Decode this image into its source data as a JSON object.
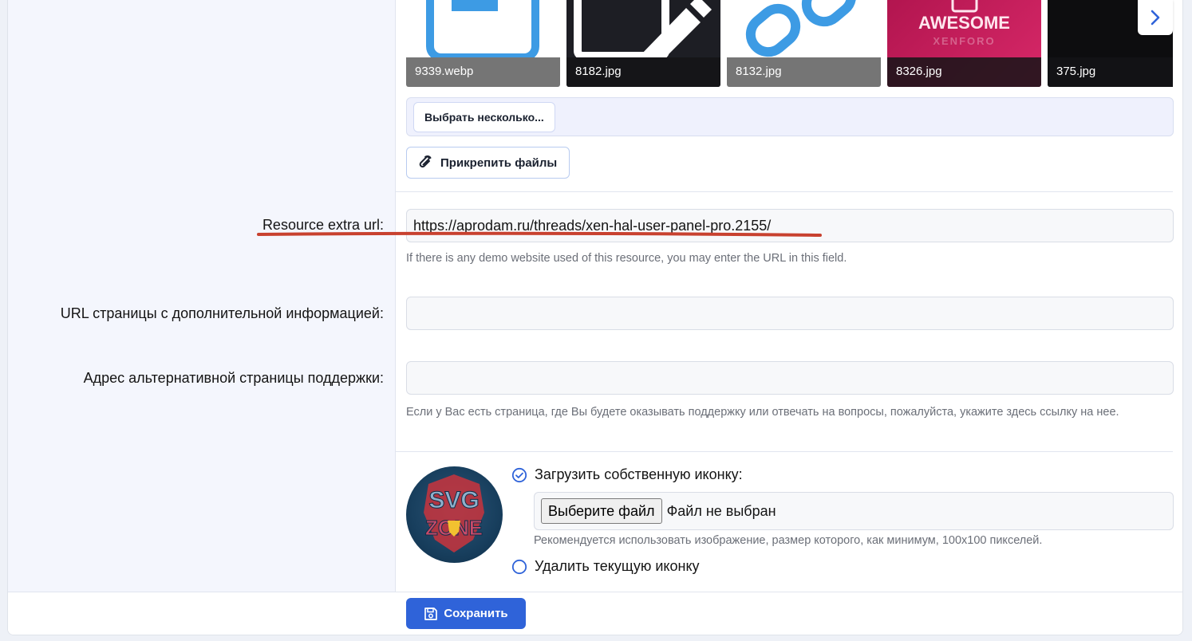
{
  "thumbnails": [
    {
      "caption": "9339.webp",
      "icon": "document-icon"
    },
    {
      "caption": "8182.jpg",
      "icon": "pencil-icon"
    },
    {
      "caption": "8132.jpg",
      "icon": "link-icon"
    },
    {
      "caption": "8326.jpg",
      "title": "AWESOME",
      "subtitle": "XENFORO"
    },
    {
      "caption": "375.jpg"
    }
  ],
  "gallery": {
    "next_icon": "chevron-right-icon"
  },
  "multi_select": {
    "label": "Выбрать несколько..."
  },
  "attach": {
    "label": "Прикрепить файлы",
    "icon": "paperclip-icon"
  },
  "fields": {
    "extra_url": {
      "label": "Resource extra url:",
      "value": "https://aprodam.ru/threads/xen-hal-user-panel-pro.2155/",
      "hint": "If there is any demo website used of this resource, you may enter the URL in this field."
    },
    "info_url": {
      "label": "URL страницы с дополнительной информацией:",
      "value": ""
    },
    "support_url": {
      "label": "Адрес альтернативной страницы поддержки:",
      "value": "",
      "hint": "Если у Вас есть страница, где Вы будете оказывать поддержку или отвечать на вопросы, пожалуйста, укажите здесь ссылку на нее."
    }
  },
  "icon_section": {
    "avatar_text": "SVG ZONE",
    "upload_option": "Загрузить собственную иконку:",
    "file_button": "Выберите файл",
    "file_status": "Файл не выбран",
    "file_hint": "Рекомендуется использовать изображение, размер которого, как минимум, 100x100 пикселей.",
    "delete_option": "Удалить текущую иконку",
    "selected": "upload"
  },
  "footer": {
    "save_label": "Сохранить",
    "save_icon": "floppy-disk-icon"
  },
  "colors": {
    "accent": "#2f63d9",
    "annotation_underline": "#c8412f",
    "radio": "#2f63d9"
  }
}
